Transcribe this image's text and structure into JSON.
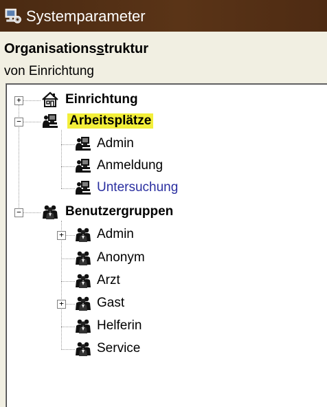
{
  "window": {
    "title": "Systemparameter",
    "icon": "settings-icon"
  },
  "heading": {
    "pre": "Organisations",
    "underlined": "s",
    "post": "truktur"
  },
  "subtitle": "von Einrichtung",
  "tree": {
    "einrichtung": {
      "label": "Einrichtung",
      "icon": "house-icon",
      "expander": "+"
    },
    "arbeitsplaetze": {
      "label": "Arbeitsplätze",
      "icon": "workstation-icon",
      "expander": "−",
      "children": {
        "admin": "Admin",
        "anmeldung": "Anmeldung",
        "untersuchung": "Untersuchung"
      }
    },
    "benutzergruppen": {
      "label": "Benutzergruppen",
      "icon": "user-group-icon",
      "expander": "−",
      "children": {
        "admin": "Admin",
        "anonym": "Anonym",
        "arzt": "Arzt",
        "gast": "Gast",
        "helferin": "Helferin",
        "service": "Service"
      },
      "expanders": {
        "admin": "+",
        "gast": "+"
      }
    }
  },
  "colors": {
    "titlebar": "#4a2a12",
    "highlight": "#f3ef3a",
    "link_blue": "#2a2fa0"
  }
}
